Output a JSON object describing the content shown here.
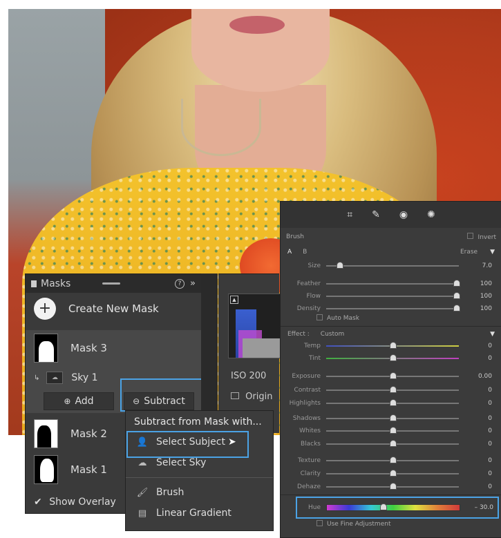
{
  "masks_panel": {
    "title": "Masks",
    "create_label": "Create New Mask",
    "items": [
      {
        "label": "Mask 3"
      },
      {
        "label": "Sky 1"
      },
      {
        "label": "Mask 2"
      },
      {
        "label": "Mask 1"
      }
    ],
    "add_label": "Add",
    "subtract_label": "Subtract",
    "show_overlay_label": "Show Overlay",
    "show_overlay_checked": true
  },
  "info": {
    "iso": "ISO 200",
    "original": "Origin"
  },
  "dropdown": {
    "title": "Subtract from Mask with...",
    "items": [
      {
        "label": "Select Subject",
        "icon": "person-icon"
      },
      {
        "label": "Select Sky",
        "icon": "sky-icon"
      },
      {
        "label": "Brush",
        "icon": "brush-icon"
      },
      {
        "label": "Linear Gradient",
        "icon": "gradient-icon"
      }
    ]
  },
  "brush_panel": {
    "brush_label": "Brush",
    "invert_label": "Invert",
    "tab_a": "A",
    "tab_b": "B",
    "erase_label": "Erase",
    "auto_mask_label": "Auto Mask",
    "effect_label": "Effect :",
    "effect_value": "Custom",
    "fine_adjustment_label": "Use Fine Adjustment",
    "brush_sliders": [
      {
        "label": "Size",
        "value": "7.0",
        "pos": 0.08
      },
      {
        "label": "Feather",
        "value": "100",
        "pos": 1.0
      },
      {
        "label": "Flow",
        "value": "100",
        "pos": 1.0
      },
      {
        "label": "Density",
        "value": "100",
        "pos": 1.0
      }
    ],
    "effect_sliders": [
      {
        "label": "Temp",
        "value": "0",
        "pos": 0.5
      },
      {
        "label": "Tint",
        "value": "0",
        "pos": 0.5
      },
      {
        "label": "Exposure",
        "value": "0.00",
        "pos": 0.5
      },
      {
        "label": "Contrast",
        "value": "0",
        "pos": 0.5
      },
      {
        "label": "Highlights",
        "value": "0",
        "pos": 0.5
      },
      {
        "label": "Shadows",
        "value": "0",
        "pos": 0.5
      },
      {
        "label": "Whites",
        "value": "0",
        "pos": 0.5
      },
      {
        "label": "Blacks",
        "value": "0",
        "pos": 0.5
      },
      {
        "label": "Texture",
        "value": "0",
        "pos": 0.5
      },
      {
        "label": "Clarity",
        "value": "0",
        "pos": 0.5
      },
      {
        "label": "Dehaze",
        "value": "0",
        "pos": 0.5
      }
    ],
    "hue": {
      "label": "Hue",
      "value": "– 30.0",
      "pos": 0.42
    }
  },
  "colors": {
    "highlight": "#4ba3e6",
    "panel": "#3a3a3a"
  }
}
